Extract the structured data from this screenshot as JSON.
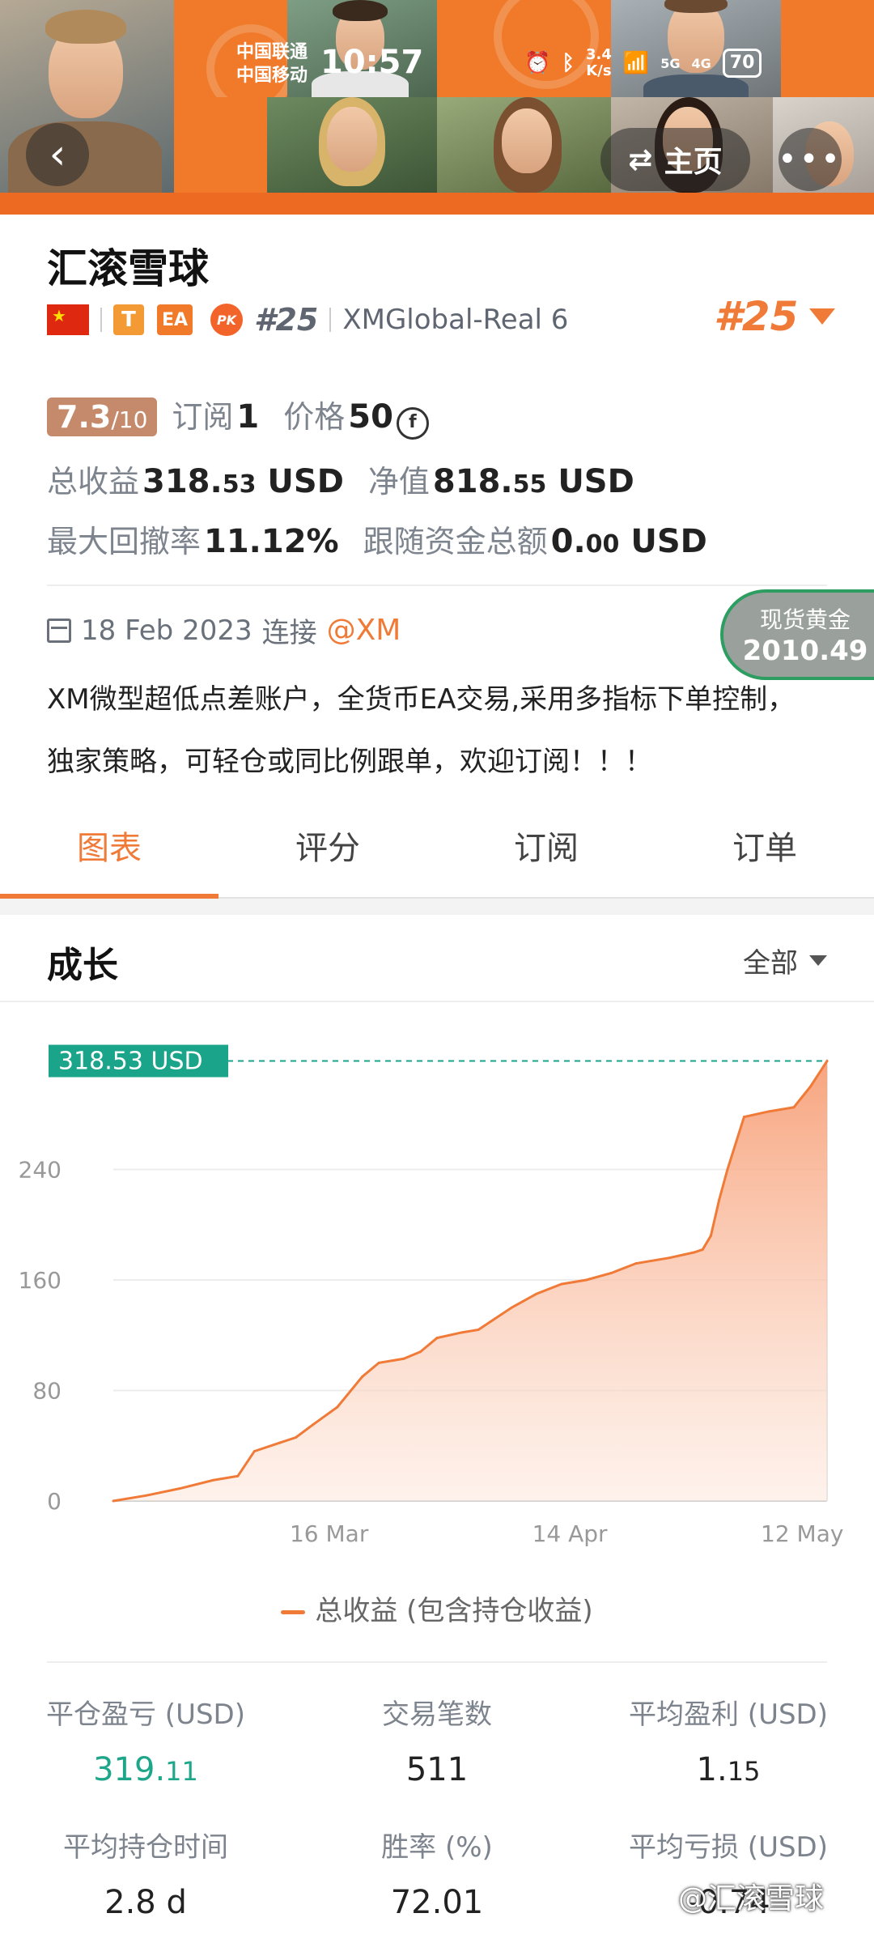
{
  "status_bar": {
    "carrier1": "中国联通",
    "carrier2": "中国移动",
    "time": "10:57",
    "net_speed_value": "3.4",
    "net_speed_unit": "K/s",
    "signal1": "5G",
    "signal2": "4G",
    "battery": "70"
  },
  "header": {
    "home_label": "主页"
  },
  "profile": {
    "name": "汇滚雪球",
    "badge_t": "T",
    "badge_ea": "EA",
    "badge_pk": "PK",
    "rank_small": "#25",
    "server": "XMGlobal-Real 6",
    "rank_big": "#25",
    "score_main": "7.3",
    "score_total": "/10",
    "subscriptions_label": "订阅",
    "subscriptions_value": "1",
    "price_label": "价格",
    "price_value": "50",
    "total_profit_label": "总收益",
    "total_profit_int": "318.",
    "total_profit_dec": "53",
    "total_profit_unit": "USD",
    "equity_label": "净值",
    "equity_int": "818.",
    "equity_dec": "55",
    "equity_unit": "USD",
    "max_drawdown_label": "最大回撤率",
    "max_drawdown_value": "11.12%",
    "follow_funds_label": "跟随资金总额",
    "follow_funds_int": "0.",
    "follow_funds_dec": "00",
    "follow_funds_unit": "USD",
    "connect_date": "18 Feb 2023",
    "connect_label": "连接",
    "broker": "@XM",
    "description_line1": "XM微型超低点差账户，全货币EA交易,采用多指标下单控制，",
    "description_line2": "独家策略，可轻仓或同比例跟单，欢迎订阅！！！"
  },
  "gold_widget": {
    "label": "现货黄金",
    "value": "2010.49"
  },
  "tabs": [
    {
      "label": "图表",
      "active": true
    },
    {
      "label": "评分",
      "active": false
    },
    {
      "label": "订阅",
      "active": false
    },
    {
      "label": "订单",
      "active": false
    }
  ],
  "section": {
    "title": "成长",
    "filter": "全部"
  },
  "chart_data": {
    "type": "area",
    "title": "",
    "x": [
      "2023-02-18",
      "2023-02-22",
      "2023-02-26",
      "2023-03-02",
      "2023-03-05",
      "2023-03-07",
      "2023-03-10",
      "2023-03-12",
      "2023-03-14",
      "2023-03-17",
      "2023-03-20",
      "2023-03-22",
      "2023-03-25",
      "2023-03-27",
      "2023-03-29",
      "2023-04-01",
      "2023-04-03",
      "2023-04-05",
      "2023-04-07",
      "2023-04-10",
      "2023-04-13",
      "2023-04-16",
      "2023-04-19",
      "2023-04-22",
      "2023-04-26",
      "2023-04-29",
      "2023-04-30",
      "2023-05-01",
      "2023-05-02",
      "2023-05-03",
      "2023-05-05",
      "2023-05-08",
      "2023-05-11",
      "2023-05-13",
      "2023-05-15"
    ],
    "series": [
      {
        "name": "总收益 (包含持仓收益)",
        "values": [
          0,
          4,
          9,
          15,
          18,
          36,
          42,
          46,
          55,
          68,
          90,
          100,
          103,
          108,
          118,
          122,
          124,
          132,
          140,
          150,
          157,
          160,
          165,
          172,
          176,
          180,
          182,
          192,
          218,
          240,
          278,
          282,
          285,
          300,
          318.53
        ]
      }
    ],
    "xticks": [
      "16 Mar",
      "14 Apr",
      "12 May"
    ],
    "xtick_values": [
      "2023-03-16",
      "2023-04-14",
      "2023-05-12"
    ],
    "yticks": [
      0,
      80,
      160,
      240
    ],
    "ylim": [
      0,
      320
    ],
    "current_value_label": "318.53 USD",
    "legend": "总收益 (包含持仓收益)",
    "grid": true,
    "legend_position": "bottom",
    "colors": {
      "line": "#f07a37",
      "fill": "#f7a078",
      "current": "#1aa58a"
    }
  },
  "stats": [
    {
      "label": "平仓盈亏 (USD)",
      "value_int": "319.",
      "value_dec": "11",
      "green": true
    },
    {
      "label": "交易笔数",
      "value_int": "511",
      "value_dec": "",
      "green": false
    },
    {
      "label": "平均盈利 (USD)",
      "value_int": "1.",
      "value_dec": "15",
      "green": false
    },
    {
      "label": "平均持仓时间",
      "value_int": "2.8 d",
      "value_dec": "",
      "green": false
    },
    {
      "label": "胜率 (%)",
      "value_int": "72.01",
      "value_dec": "",
      "green": false
    },
    {
      "label": "平均亏损 (USD)",
      "value_int": "-0.74",
      "value_dec": "",
      "green": false
    }
  ],
  "watermark": "@汇滚雪球"
}
